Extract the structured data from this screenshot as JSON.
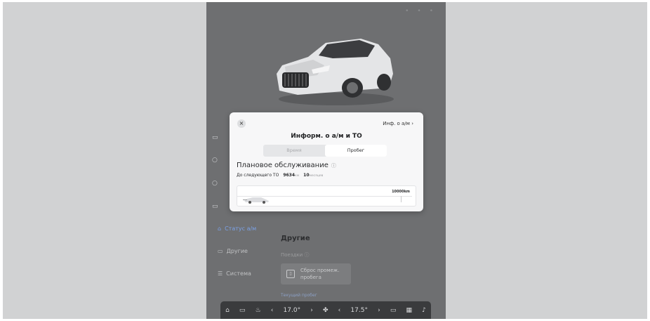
{
  "status_icons": [
    "•",
    "•",
    "•"
  ],
  "sidebar": {
    "items": [
      {
        "label": "Статус а/м",
        "icon": "car-status-icon",
        "active": true
      },
      {
        "label": "Другие",
        "icon": "car-icon",
        "active": false
      },
      {
        "label": "Система",
        "icon": "settings-sliders-icon",
        "active": false
      }
    ]
  },
  "main": {
    "section_title": "Другие",
    "trips_label": "Поездки",
    "reset_button": "Сброс промеж. пробега",
    "current_mileage": "Текущий пробег"
  },
  "modal": {
    "close_glyph": "×",
    "info_link": "Инф. о а/м",
    "title": "Информ. о а/м и ТО",
    "tabs": [
      {
        "label": "Время",
        "selected": false
      },
      {
        "label": "Пробег",
        "selected": true
      }
    ],
    "maintenance_title": "Плановое обслуживание",
    "next_service_label": "До следующего ТО",
    "next_service_km": "9634",
    "km_unit": "км",
    "next_service_months": "10",
    "months_unit": "месяцев",
    "progress_end_label": "10000km"
  },
  "bottom_bar": {
    "temp_left": "17.0°",
    "temp_right": "17.5°"
  }
}
